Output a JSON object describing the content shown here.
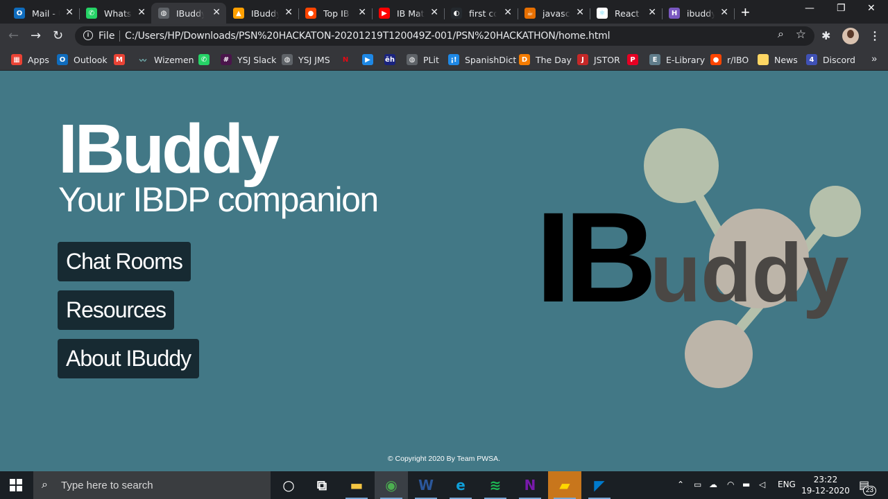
{
  "browser": {
    "tabs": [
      {
        "title": "Mail - U",
        "icon": "outlook-icon",
        "color": "#0f6cbd",
        "glyph": "O"
      },
      {
        "title": "WhatsA",
        "icon": "whatsapp-icon",
        "color": "#25d366",
        "glyph": "✆"
      },
      {
        "title": "IBuddy",
        "icon": "globe-icon",
        "color": "#5f6368",
        "glyph": "◍"
      },
      {
        "title": "IBuddy",
        "icon": "firebase-icon",
        "color": "#ffa000",
        "glyph": "▲"
      },
      {
        "title": "Top IB F",
        "icon": "reddit-icon",
        "color": "#ff4500",
        "glyph": "●"
      },
      {
        "title": "IB Math",
        "icon": "youtube-icon",
        "color": "#ff0000",
        "glyph": "▶"
      },
      {
        "title": "first cor",
        "icon": "github-icon",
        "color": "#24292e",
        "glyph": "◐"
      },
      {
        "title": "javascri",
        "icon": "java-icon",
        "color": "#e76f00",
        "glyph": "☕"
      },
      {
        "title": "React R",
        "icon": "react-icon",
        "color": "#ffffff",
        "glyph": "⚛"
      },
      {
        "title": "ibuddy",
        "icon": "heroku-icon",
        "color": "#7a58c1",
        "glyph": "H"
      }
    ],
    "active_tab": 2,
    "new_tab_label": "+",
    "window_controls": {
      "minimize": "—",
      "restore": "❐",
      "close": "✕"
    },
    "nav": {
      "back": "←",
      "forward": "→",
      "reload": "↻"
    },
    "omnibox": {
      "info": "i",
      "scheme_label": "File",
      "url": "C:/Users/HP/Downloads/PSN%20HACKATON-20201219T120049Z-001/PSN%20HACKATHON/home.html",
      "zoom_glyph": "⌕",
      "star_glyph": "☆"
    },
    "extensions_glyph": "✱",
    "menu_glyph": "⋮",
    "bookmarks": [
      {
        "label": "Apps",
        "icon": "apps-grid-icon",
        "color": "#ea4335",
        "glyph": "▦"
      },
      {
        "label": "Outlook",
        "icon": "outlook-icon",
        "color": "#0f6cbd",
        "glyph": "O"
      },
      {
        "label": "",
        "icon": "gmail-icon",
        "color": "#ea4335",
        "glyph": "M"
      },
      {
        "label": "Wizemen",
        "icon": "wizemen-icon",
        "color": "#35363a",
        "glyph": "〰"
      },
      {
        "label": "",
        "icon": "whatsapp-icon",
        "color": "#25d366",
        "glyph": "✆"
      },
      {
        "label": "YSJ Slack",
        "icon": "slack-icon",
        "color": "#4a154b",
        "glyph": "#"
      },
      {
        "label": "YSJ JMS",
        "icon": "globe-icon",
        "color": "#5f6368",
        "glyph": "◍"
      },
      {
        "label": "",
        "icon": "netflix-icon",
        "color": "#35363a",
        "glyph": "N"
      },
      {
        "label": "",
        "icon": "play-icon",
        "color": "#1e88e5",
        "glyph": "▶"
      },
      {
        "label": "",
        "icon": "eh-icon",
        "color": "#1a237e",
        "glyph": "ēh"
      },
      {
        "label": "PLit",
        "icon": "globe-icon",
        "color": "#5f6368",
        "glyph": "◍"
      },
      {
        "label": "SpanishDict",
        "icon": "spanishdict-icon",
        "color": "#1e88e5",
        "glyph": "¡!"
      },
      {
        "label": "The Day",
        "icon": "theday-icon",
        "color": "#f57c00",
        "glyph": "D"
      },
      {
        "label": "JSTOR",
        "icon": "jstor-icon",
        "color": "#c62828",
        "glyph": "J"
      },
      {
        "label": "",
        "icon": "pinterest-icon",
        "color": "#e60023",
        "glyph": "P"
      },
      {
        "label": "E-Library",
        "icon": "elibrary-icon",
        "color": "#607d8b",
        "glyph": "E"
      },
      {
        "label": "r/IBO",
        "icon": "reddit-icon",
        "color": "#ff4500",
        "glyph": "●"
      },
      {
        "label": "News",
        "icon": "folder-icon",
        "color": "#fdd663",
        "glyph": ""
      },
      {
        "label": "Discord",
        "icon": "discord-calendar-icon",
        "color": "#3f51b5",
        "glyph": "4"
      }
    ],
    "bookmarks_more": "»"
  },
  "page": {
    "title": "IBuddy",
    "subtitle": "Your IBDP companion",
    "buttons": [
      "Chat Rooms",
      "Resources",
      "About IBuddy"
    ],
    "logo": {
      "text_dark": "IB",
      "text_light": "uddy"
    },
    "copyright": "© Copyright 2020 By Team PWSA."
  },
  "taskbar": {
    "search_placeholder": "Type here to search",
    "apps": [
      {
        "name": "cortana-icon",
        "glyph": "○",
        "color": "#ffffff"
      },
      {
        "name": "task-view-icon",
        "glyph": "⧉",
        "color": "#ffffff"
      },
      {
        "name": "file-explorer-icon",
        "glyph": "▬",
        "color": "#f4c542"
      },
      {
        "name": "chrome-icon",
        "glyph": "◉",
        "color": "#4caf50"
      },
      {
        "name": "word-icon",
        "glyph": "W",
        "color": "#2b579a"
      },
      {
        "name": "edge-icon",
        "glyph": "e",
        "color": "#0f9fd8"
      },
      {
        "name": "spotify-icon",
        "glyph": "≋",
        "color": "#1db954"
      },
      {
        "name": "onenote-icon",
        "glyph": "N",
        "color": "#7719aa"
      },
      {
        "name": "sticky-notes-icon",
        "glyph": "▰",
        "color": "#ffd700"
      },
      {
        "name": "vscode-icon",
        "glyph": "◤",
        "color": "#007acc"
      }
    ],
    "tray": {
      "chevron": "⌃",
      "lang": "ENG"
    },
    "time": "23:22",
    "date": "19-12-2020",
    "notifications": "23"
  },
  "colors": {
    "page_bg": "#427886",
    "button_bg": "#172a32",
    "logo_dark": "#000000",
    "logo_light": "#4a4744",
    "node_color": "#b5c0ab",
    "hub_color": "#bdb5a9"
  }
}
